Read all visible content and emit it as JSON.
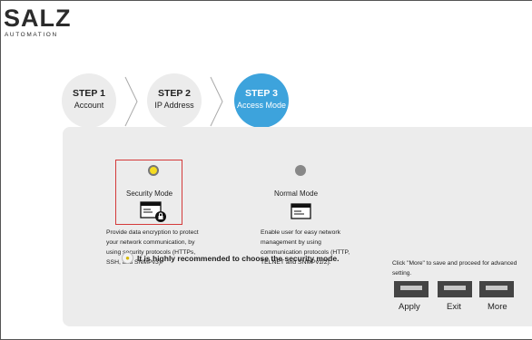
{
  "brand": {
    "logo_text": "SALZ",
    "logo_sub": "AUTOMATION"
  },
  "steps": [
    {
      "num": "STEP 1",
      "label": "Account",
      "state": "inactive"
    },
    {
      "num": "STEP 2",
      "label": "IP Address",
      "state": "inactive"
    },
    {
      "num": "STEP 3",
      "label": "Access Mode",
      "state": "active"
    }
  ],
  "modes": {
    "security": {
      "title": "Security Mode",
      "selected": true,
      "desc": [
        "Provide data encryption to protect",
        "your network communication, by",
        "using security protocols (HTTPs,",
        "SSH, and SNMPv3)."
      ]
    },
    "normal": {
      "title": "Normal Mode",
      "selected": false,
      "desc": [
        "Enable user for easy network",
        "management by using",
        "communication protocols (HTTP,",
        "TELNET and SNMPv1/2)."
      ]
    }
  },
  "recommendation": "It is highly recommended to choose the security mode.",
  "note": [
    "Click \"More\" to save and proceed for advanced",
    "setting."
  ],
  "actions": {
    "apply": "Apply",
    "exit": "Exit",
    "more": "More"
  },
  "colors": {
    "active_step": "#3da3dc",
    "selection_border": "#d43a3a",
    "radio_selected": "#f5dc22"
  }
}
